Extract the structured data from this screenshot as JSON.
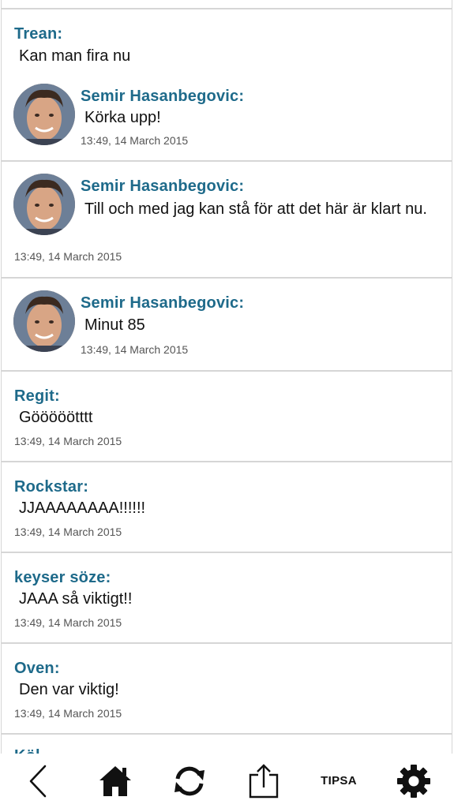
{
  "feed": {
    "posts": [
      {
        "author": "Trean:",
        "message": "Kan man fira nu",
        "reply": {
          "author": "Semir Hasanbegovic:",
          "message": "Körka upp!",
          "time": "13:49, 14 March 2015"
        }
      },
      {
        "author": "Semir Hasanbegovic:",
        "message": "Till och med jag kan stå för att det här är klart nu.",
        "time": "13:49, 14 March 2015"
      },
      {
        "author": "Semir Hasanbegovic:",
        "message": "Minut 85",
        "time": "13:49, 14 March 2015"
      },
      {
        "author": "Regit:",
        "message": "Gööööötttt",
        "time": "13:49, 14 March 2015"
      },
      {
        "author": "Rockstar:",
        "message": "JJAAAAAAAA!!!!!!",
        "time": "13:49, 14 March 2015"
      },
      {
        "author": "keyser söze:",
        "message": "JAAA så viktigt!!",
        "time": "13:49, 14 March 2015"
      },
      {
        "author": "Oven:",
        "message": "Den var viktig!",
        "time": "13:49, 14 March 2015"
      },
      {
        "author": "Köl",
        "message": ""
      }
    ]
  },
  "toolbar": {
    "back_icon": "chevron-left-icon",
    "home_icon": "home-icon",
    "refresh_icon": "refresh-icon",
    "share_icon": "share-icon",
    "tipsa_label": "TIPSA",
    "settings_icon": "gear-icon"
  },
  "colors": {
    "author": "#1e6a8a",
    "divider": "#d6d6d6",
    "text": "#111111",
    "timestamp": "#555555"
  }
}
